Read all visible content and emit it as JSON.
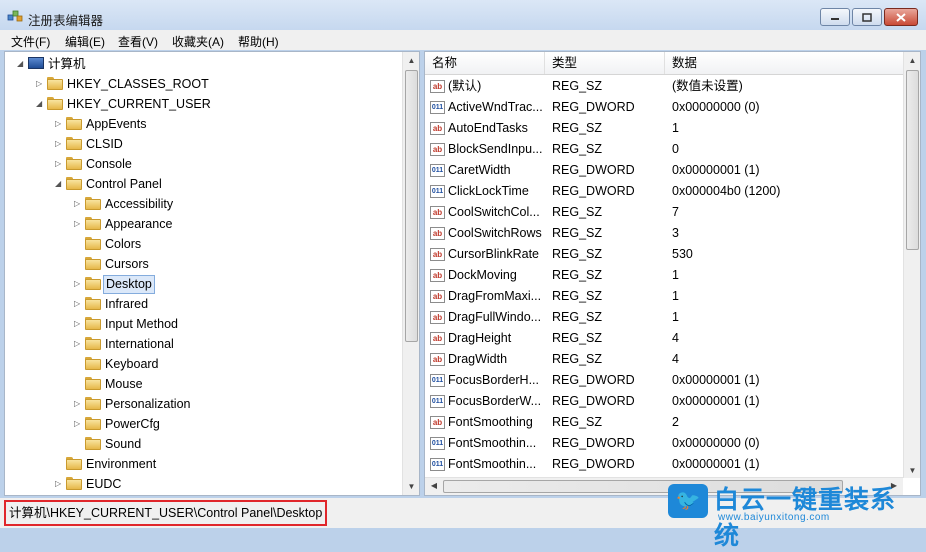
{
  "window": {
    "title": "注册表编辑器"
  },
  "menu": [
    "文件(F)",
    "编辑(E)",
    "查看(V)",
    "收藏夹(A)",
    "帮助(H)"
  ],
  "tree": [
    {
      "label": "计算机",
      "level": 0,
      "arrow": "expanded",
      "icon": "computer"
    },
    {
      "label": "HKEY_CLASSES_ROOT",
      "level": 1,
      "arrow": "collapsed"
    },
    {
      "label": "HKEY_CURRENT_USER",
      "level": 1,
      "arrow": "expanded"
    },
    {
      "label": "AppEvents",
      "level": 2,
      "arrow": "collapsed"
    },
    {
      "label": "CLSID",
      "level": 2,
      "arrow": "collapsed"
    },
    {
      "label": "Console",
      "level": 2,
      "arrow": "collapsed"
    },
    {
      "label": "Control Panel",
      "level": 2,
      "arrow": "expanded"
    },
    {
      "label": "Accessibility",
      "level": 3,
      "arrow": "collapsed"
    },
    {
      "label": "Appearance",
      "level": 3,
      "arrow": "collapsed"
    },
    {
      "label": "Colors",
      "level": 3,
      "arrow": "none"
    },
    {
      "label": "Cursors",
      "level": 3,
      "arrow": "none"
    },
    {
      "label": "Desktop",
      "level": 3,
      "arrow": "collapsed",
      "selected": true
    },
    {
      "label": "Infrared",
      "level": 3,
      "arrow": "collapsed"
    },
    {
      "label": "Input Method",
      "level": 3,
      "arrow": "collapsed"
    },
    {
      "label": "International",
      "level": 3,
      "arrow": "collapsed"
    },
    {
      "label": "Keyboard",
      "level": 3,
      "arrow": "none"
    },
    {
      "label": "Mouse",
      "level": 3,
      "arrow": "none"
    },
    {
      "label": "Personalization",
      "level": 3,
      "arrow": "collapsed"
    },
    {
      "label": "PowerCfg",
      "level": 3,
      "arrow": "collapsed"
    },
    {
      "label": "Sound",
      "level": 3,
      "arrow": "none"
    },
    {
      "label": "Environment",
      "level": 2,
      "arrow": "none"
    },
    {
      "label": "EUDC",
      "level": 2,
      "arrow": "collapsed"
    }
  ],
  "columns": [
    "名称",
    "类型",
    "数据"
  ],
  "values": [
    {
      "name": "(默认)",
      "type": "REG_SZ",
      "data": "(数值未设置)",
      "icon": "sz"
    },
    {
      "name": "ActiveWndTrac...",
      "type": "REG_DWORD",
      "data": "0x00000000 (0)",
      "icon": "dword"
    },
    {
      "name": "AutoEndTasks",
      "type": "REG_SZ",
      "data": "1",
      "icon": "sz"
    },
    {
      "name": "BlockSendInpu...",
      "type": "REG_SZ",
      "data": "0",
      "icon": "sz"
    },
    {
      "name": "CaretWidth",
      "type": "REG_DWORD",
      "data": "0x00000001 (1)",
      "icon": "dword"
    },
    {
      "name": "ClickLockTime",
      "type": "REG_DWORD",
      "data": "0x000004b0 (1200)",
      "icon": "dword"
    },
    {
      "name": "CoolSwitchCol...",
      "type": "REG_SZ",
      "data": "7",
      "icon": "sz"
    },
    {
      "name": "CoolSwitchRows",
      "type": "REG_SZ",
      "data": "3",
      "icon": "sz"
    },
    {
      "name": "CursorBlinkRate",
      "type": "REG_SZ",
      "data": "530",
      "icon": "sz"
    },
    {
      "name": "DockMoving",
      "type": "REG_SZ",
      "data": "1",
      "icon": "sz"
    },
    {
      "name": "DragFromMaxi...",
      "type": "REG_SZ",
      "data": "1",
      "icon": "sz"
    },
    {
      "name": "DragFullWindo...",
      "type": "REG_SZ",
      "data": "1",
      "icon": "sz"
    },
    {
      "name": "DragHeight",
      "type": "REG_SZ",
      "data": "4",
      "icon": "sz"
    },
    {
      "name": "DragWidth",
      "type": "REG_SZ",
      "data": "4",
      "icon": "sz"
    },
    {
      "name": "FocusBorderH...",
      "type": "REG_DWORD",
      "data": "0x00000001 (1)",
      "icon": "dword"
    },
    {
      "name": "FocusBorderW...",
      "type": "REG_DWORD",
      "data": "0x00000001 (1)",
      "icon": "dword"
    },
    {
      "name": "FontSmoothing",
      "type": "REG_SZ",
      "data": "2",
      "icon": "sz"
    },
    {
      "name": "FontSmoothin...",
      "type": "REG_DWORD",
      "data": "0x00000000 (0)",
      "icon": "dword"
    },
    {
      "name": "FontSmoothin...",
      "type": "REG_DWORD",
      "data": "0x00000001 (1)",
      "icon": "dword"
    }
  ],
  "status": {
    "path": "计算机\\HKEY_CURRENT_USER\\Control Panel\\Desktop"
  },
  "watermark": {
    "title": "白云一键重装系统",
    "url": "www.baiyunxitong.com"
  },
  "icons": {
    "sz": "ab",
    "dword": "011"
  }
}
